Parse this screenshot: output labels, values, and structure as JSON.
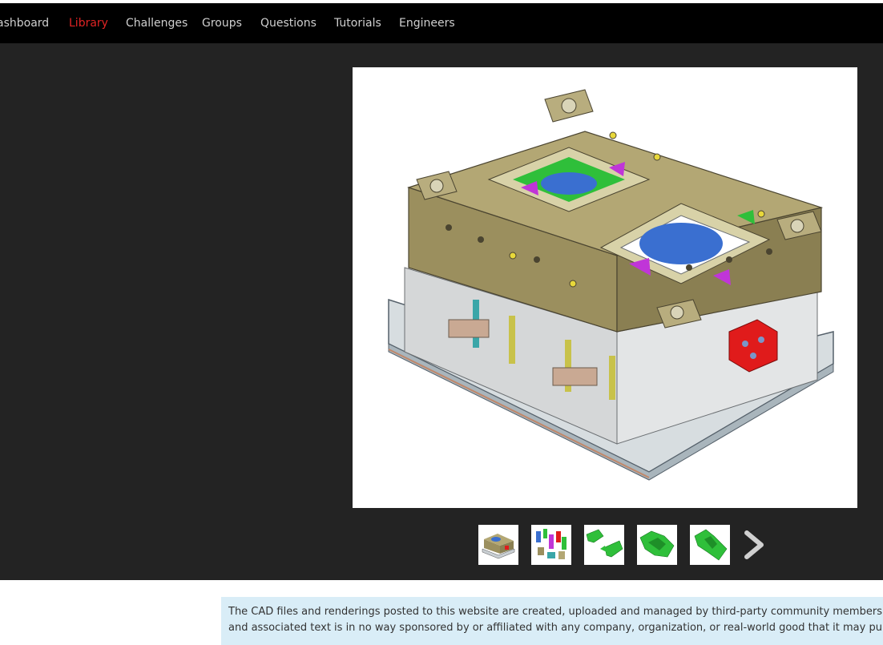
{
  "nav": {
    "items": [
      {
        "label": "ashboard",
        "active": false
      },
      {
        "label": "Library",
        "active": true
      },
      {
        "label": "Challenges",
        "active": false
      },
      {
        "label": "Groups",
        "active": false
      },
      {
        "label": "Questions",
        "active": false
      },
      {
        "label": "Tutorials",
        "active": false
      },
      {
        "label": "Engineers",
        "active": false
      }
    ],
    "active_color": "#e02424",
    "text_color": "#cfcfcf",
    "background": "#000000"
  },
  "viewer": {
    "background": "#232323",
    "main_image": "injection-mold-assembly-render",
    "thumbnails": [
      "mold-assembly-thumbnail",
      "exploded-components-thumbnail",
      "green-parts-pair-thumbnail",
      "green-part-thumbnail",
      "green-part-side-thumbnail"
    ],
    "next_icon": "chevron-right-icon"
  },
  "notice": {
    "line1": "The CAD files and renderings posted to this website are created, uploaded and managed by third-party community members. This content",
    "line2": "and associated text is in no way sponsored by or affiliated with any company, organization, or real-world good that it may purport to portray.",
    "background": "#d9edf7"
  }
}
